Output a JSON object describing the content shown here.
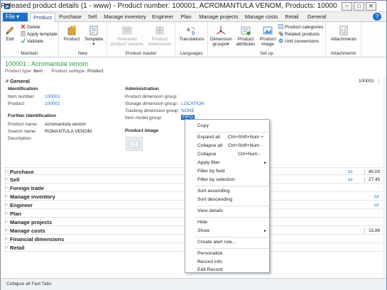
{
  "window": {
    "title": "Released product details (1 - www) - Product number: 100001, ACROMANTULA VENOM, Products: 100001",
    "minimize": "–",
    "maximize": "□",
    "close": "✕"
  },
  "ribbon_tabs": {
    "file": "File ▾",
    "tabs": [
      "Product",
      "Purchase",
      "Sell",
      "Manage inventory",
      "Engineer",
      "Plan",
      "Manage projects",
      "Manage costs",
      "Retail",
      "General"
    ],
    "help": "?"
  },
  "ribbon": {
    "maintain": {
      "label": "Maintain",
      "edit": "Edit",
      "delete": "Delete",
      "apply_template": "Apply template",
      "validate": "Validate"
    },
    "new": {
      "label": "New",
      "product": "Product",
      "template": "Template"
    },
    "product_master": {
      "label": "Product master",
      "released_variants": "Released product variants",
      "product_dimensions": "Product dimensions"
    },
    "languages": {
      "label": "Languages",
      "translations": "Translations"
    },
    "setup": {
      "label": "Set up",
      "dimension_groups": "Dimension groups",
      "product_attributes": "Product attributes",
      "product_image": "Product image",
      "product_categories": "Product categories",
      "related_products": "Related products",
      "unit_conversions": "Unit conversions"
    },
    "attachments": {
      "label": "Attachments",
      "attachments": "Attachments"
    }
  },
  "record": {
    "header": "100001 : Acromantula venom",
    "product_type_label": "Product type:",
    "product_type": "Item",
    "product_subtype_label": "Product subtype:",
    "product_subtype": "Product"
  },
  "general": {
    "title": "General",
    "summary": "100001",
    "identification_title": "Identification",
    "item_number_label": "Item number:",
    "item_number": "100001",
    "product_label": "Product:",
    "product": "100001",
    "further_title": "Further identification",
    "product_name_label": "Product name:",
    "product_name": "Acromantula venom",
    "search_name_label": "Search name:",
    "search_name": "ROMANTULA VENOM",
    "description_label": "Description:",
    "administration_title": "Administration",
    "pdg_label": "Product dimension group:",
    "pdg": "",
    "sdg_label": "Storage dimension group:",
    "sdg": "LOCATION",
    "tdg_label": "Tracking dimension group:",
    "tdg": "NONE",
    "img_label": "Item model group:",
    "img": "FIFO",
    "product_image_title": "Product image"
  },
  "fasttabs": [
    {
      "title": "Purchase",
      "s1": "oz",
      "s2": "40.00"
    },
    {
      "title": "Sell",
      "s1": "oz",
      "s2": "27.45"
    },
    {
      "title": "Foreign trade",
      "s1": "",
      "s2": ""
    },
    {
      "title": "Manage inventory",
      "s1": "oz",
      "s2": ""
    },
    {
      "title": "Engineer",
      "s1": "oz",
      "s2": ""
    },
    {
      "title": "Plan",
      "s1": "",
      "s2": ""
    },
    {
      "title": "Manage projects",
      "s1": "",
      "s2": ""
    },
    {
      "title": "Manage costs",
      "s1": "",
      "s2": "15.86"
    },
    {
      "title": "Financial dimensions",
      "s1": "",
      "s2": ""
    },
    {
      "title": "Retail",
      "s1": "",
      "s2": ""
    }
  ],
  "context_menu": {
    "copy": "Copy",
    "expand_all": "Expand all",
    "expand_all_sc": "Ctrl+Shift+Num +",
    "collapse_all": "Collapse all",
    "collapse_all_sc": "Ctrl+Shift+Num -",
    "collapse": "Collapse",
    "collapse_sc": "Ctrl+Num -",
    "apply_filter": "Apply filter",
    "filter_by_field": "Filter by field",
    "filter_by_selection": "Filter by selection",
    "sort_ascending": "Sort ascending",
    "sort_descending": "Sort descending",
    "view_details": "View details",
    "hide": "Hide",
    "show": "Show",
    "create_alert": "Create alert rule...",
    "personalize": "Personalize",
    "record_info": "Record info",
    "edit_record": "Edit Record",
    "submenu_arrow": "▸"
  },
  "status": {
    "collapse_all": "Collapse all Fast Tabs"
  }
}
